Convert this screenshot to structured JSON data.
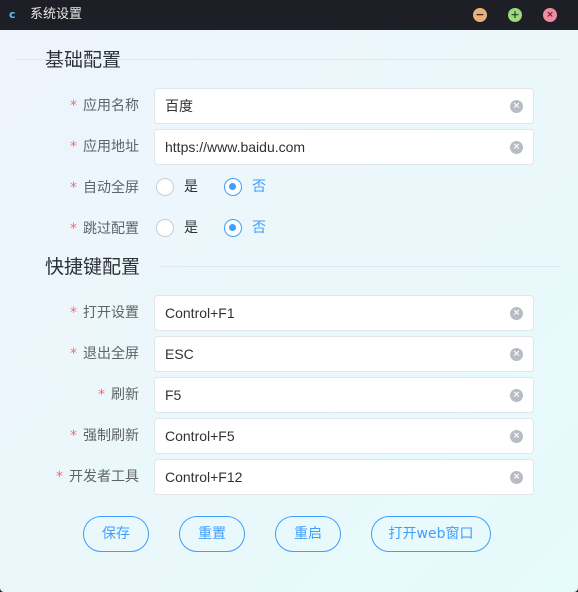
{
  "window": {
    "title": "系统设置",
    "app_icon": "app-logo-icon"
  },
  "window_controls": {
    "minimize": "−",
    "maximize": "+",
    "close": "×"
  },
  "sections": {
    "basic": {
      "title": "基础配置"
    },
    "shortcuts": {
      "title": "快捷键配置"
    }
  },
  "required_mark": "*",
  "clear_glyph": "×",
  "basic": {
    "app_name": {
      "label": "应用名称",
      "value": "百度"
    },
    "app_url": {
      "label": "应用地址",
      "value": "https://www.baidu.com"
    },
    "auto_fullscreen": {
      "label": "自动全屏",
      "yes": "是",
      "no": "否",
      "selected": "否"
    },
    "skip_config": {
      "label": "跳过配置",
      "yes": "是",
      "no": "否",
      "selected": "否"
    }
  },
  "shortcuts": {
    "open_settings": {
      "label": "打开设置",
      "value": "Control+F1"
    },
    "exit_fullscreen": {
      "label": "退出全屏",
      "value": "ESC"
    },
    "refresh": {
      "label": "刷新",
      "value": "F5"
    },
    "force_refresh": {
      "label": "强制刷新",
      "value": "Control+F5"
    },
    "devtools": {
      "label": "开发者工具",
      "value": "Control+F12"
    }
  },
  "buttons": {
    "save": "保存",
    "reset": "重置",
    "restart": "重启",
    "open_web": "打开web窗口"
  },
  "colors": {
    "accent": "#409eff",
    "required": "#f56c6c",
    "titlebar": "#1e1f26"
  }
}
